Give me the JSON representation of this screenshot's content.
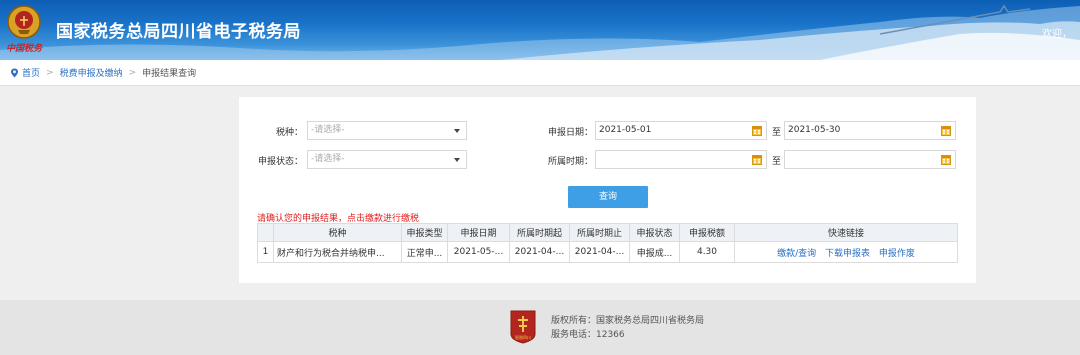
{
  "header": {
    "title": "国家税务总局四川省电子税务局",
    "welcome": "欢迎，",
    "emblem_script": "中国税务"
  },
  "breadcrumb": {
    "home": "首页",
    "parent": "税费申报及缴纳",
    "current": "申报结果查询",
    "sep": ">"
  },
  "form": {
    "tax_type_label": "税种：",
    "tax_type_value": "-请选择-",
    "status_label": "申报状态：",
    "status_value": "-请选择-",
    "report_date_label": "申报日期：",
    "report_date_from": "2021-05-01",
    "to_label": "至",
    "report_date_to": "2021-05-30",
    "period_label": "所属时期：",
    "period_from": "",
    "period_to": "",
    "query_button": "查询"
  },
  "notice": "请确认您的申报结果，点击缴款进行缴税",
  "table": {
    "headers": [
      "",
      "税种",
      "申报类型",
      "申报日期",
      "所属时期起",
      "所属时期止",
      "申报状态",
      "申报税额",
      "快速链接"
    ],
    "rows": [
      {
        "index": "1",
        "tax_type": "财产和行为税合并纳税申...",
        "report_type": "正常申...",
        "report_date": "2021-05-...",
        "period_start": "2021-04-...",
        "period_end": "2021-04-...",
        "status": "申报成...",
        "amount": "4.30",
        "links": [
          "缴款/查询",
          "下载申报表",
          "申报作废"
        ]
      }
    ]
  },
  "footer": {
    "copyright": "版权所有：国家税务总局四川省税务局",
    "phone": "服务电话：12366",
    "logo_text": "智税四川"
  }
}
